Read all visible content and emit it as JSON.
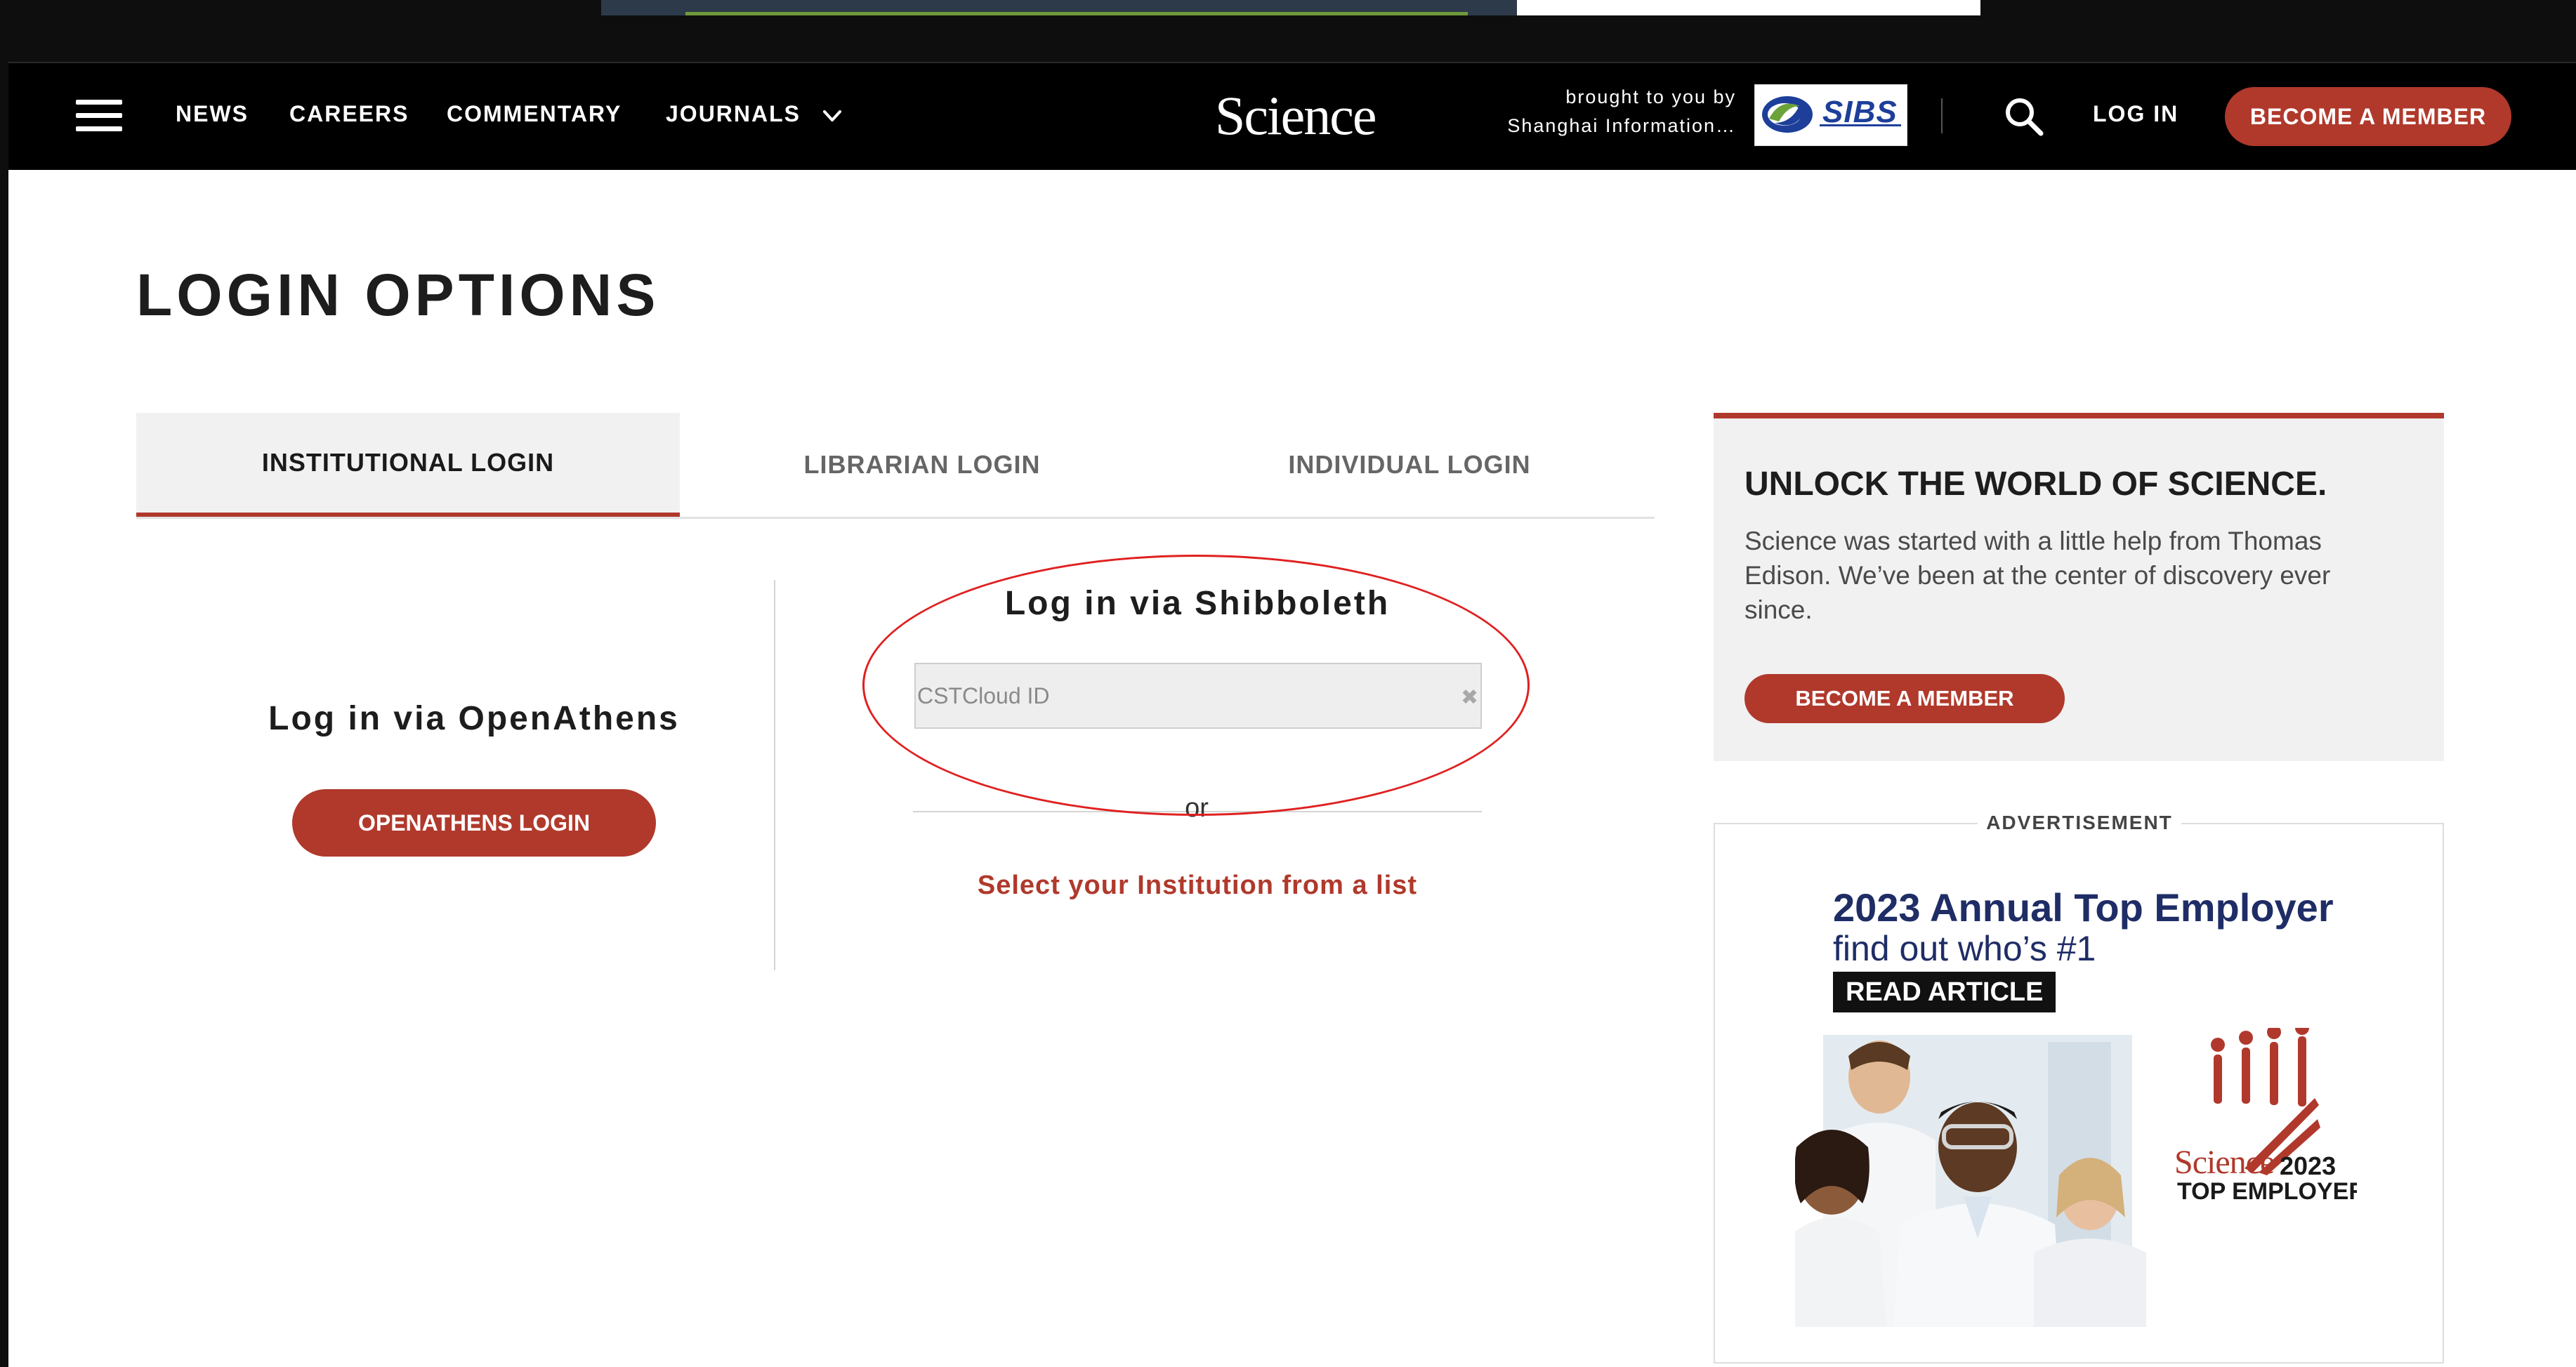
{
  "nav": {
    "menu_icon": "hamburger-icon",
    "links": [
      "NEWS",
      "CAREERS",
      "COMMENTARY",
      "JOURNALS"
    ],
    "journals_icon": "chevron-down-icon",
    "logo": "Science",
    "sponsor_line1": "brought to you by",
    "sponsor_line2": "Shanghai Information…",
    "sponsor_logo_text": "SIBS",
    "search_icon": "search-icon",
    "login": "LOG IN",
    "member_button": "BECOME A MEMBER"
  },
  "page": {
    "title": "LOGIN OPTIONS"
  },
  "tabs": {
    "active": "INSTITUTIONAL LOGIN",
    "items": [
      "INSTITUTIONAL LOGIN",
      "LIBRARIAN LOGIN",
      "INDIVIDUAL LOGIN"
    ]
  },
  "openathens": {
    "heading": "Log in via OpenAthens",
    "button": "OPENATHENS LOGIN"
  },
  "shibboleth": {
    "heading": "Log in via Shibboleth",
    "input_value": "",
    "input_placeholder": "CSTCloud ID",
    "clear_glyph": "✖",
    "or_text": "or",
    "institution_link": "Select your Institution from a list"
  },
  "promo": {
    "title": "UNLOCK THE WORLD OF SCIENCE.",
    "body": "Science was started with a little help from Thomas Edison. We’ve been at the center of discovery ever since.",
    "button": "BECOME A MEMBER"
  },
  "advertisement": {
    "label": "ADVERTISEMENT",
    "headline": "2023 Annual Top Employer",
    "subline": "find out who’s #1",
    "cta": "READ ARTICLE",
    "logo_science": "Science",
    "logo_year": "2023",
    "logo_caption": "TOP EMPLOYER"
  },
  "colors": {
    "brand_red": "#b0392c",
    "nav_background": "#000000",
    "annotation_red": "#e02020",
    "ad_headline_navy": "#1f2d66"
  }
}
